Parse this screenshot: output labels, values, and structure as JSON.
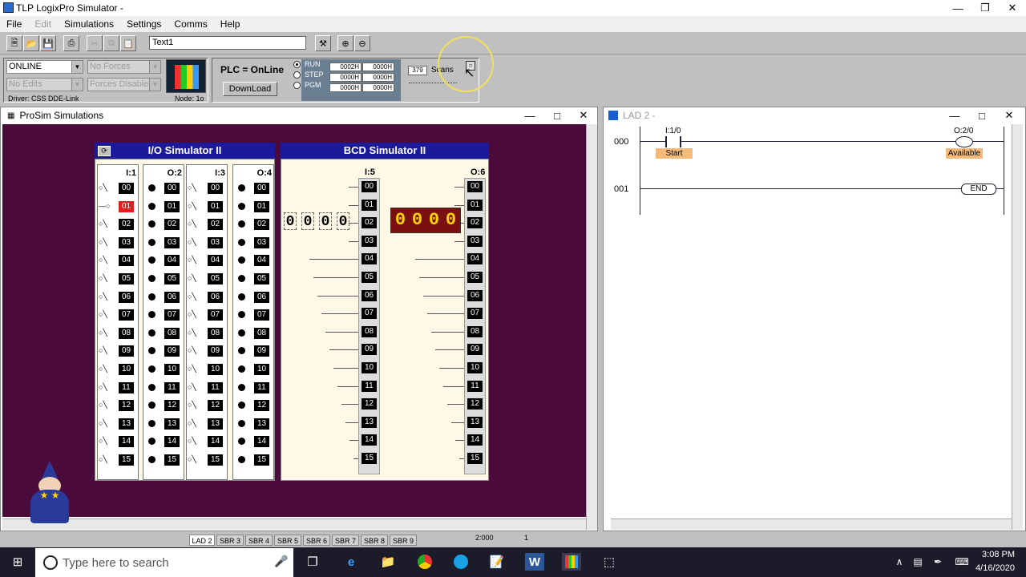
{
  "window": {
    "title": "TLP LogixPro Simulator  -"
  },
  "menu": [
    "File",
    "Edit",
    "Simulations",
    "Settings",
    "Comms",
    "Help"
  ],
  "toolbar": {
    "text_field": "Text1"
  },
  "status": {
    "mode_select": "ONLINE",
    "forces_select": "No Forces",
    "edits_select": "No Edits",
    "forces_disabled_select": "Forces Disabled",
    "driver": "Driver: CSS DDE-Link",
    "node": "Node: 1o",
    "plc_state": "PLC = OnLine",
    "download_label": "DownLoad",
    "modes": [
      "RUN",
      "STEP",
      "PGM"
    ],
    "mode_values": [
      "0002H",
      "0000H",
      "0000H"
    ],
    "mode_values2": [
      "0000H",
      "0000H",
      "0000H"
    ],
    "scan_count": "379",
    "scan_label": "Scans"
  },
  "prosim": {
    "title": "ProSim Simulations",
    "io_title": "I/O Simulator II",
    "bcd_title": "BCD Simulator II",
    "slots": [
      "I:1",
      "O:2",
      "I:3",
      "O:4"
    ],
    "bcd_slots": [
      "I:5",
      "O:6"
    ],
    "bits": [
      "00",
      "01",
      "02",
      "03",
      "04",
      "05",
      "06",
      "07",
      "08",
      "09",
      "10",
      "11",
      "12",
      "13",
      "14",
      "15"
    ],
    "active_input": 1,
    "thumbwheel": [
      "0",
      "0",
      "0",
      "0"
    ],
    "bcd_display": [
      "0",
      "0",
      "0",
      "0"
    ]
  },
  "ladder": {
    "title": "LAD 2 -",
    "rungs": [
      "000",
      "001"
    ],
    "contact_address": "I:1/0",
    "contact_desc": "Start",
    "coil_address": "O:2/0",
    "coil_desc": "Available",
    "end_label": "END"
  },
  "tabs": [
    "LAD 2",
    "SBR 3",
    "SBR 4",
    "SBR 5",
    "SBR 6",
    "SBR 7",
    "SBR 8",
    "SBR 9"
  ],
  "statusbar": {
    "address": "2:000",
    "value": "1"
  },
  "taskbar": {
    "search_placeholder": "Type here to search",
    "time": "3:08 PM",
    "date": "4/16/2020"
  }
}
